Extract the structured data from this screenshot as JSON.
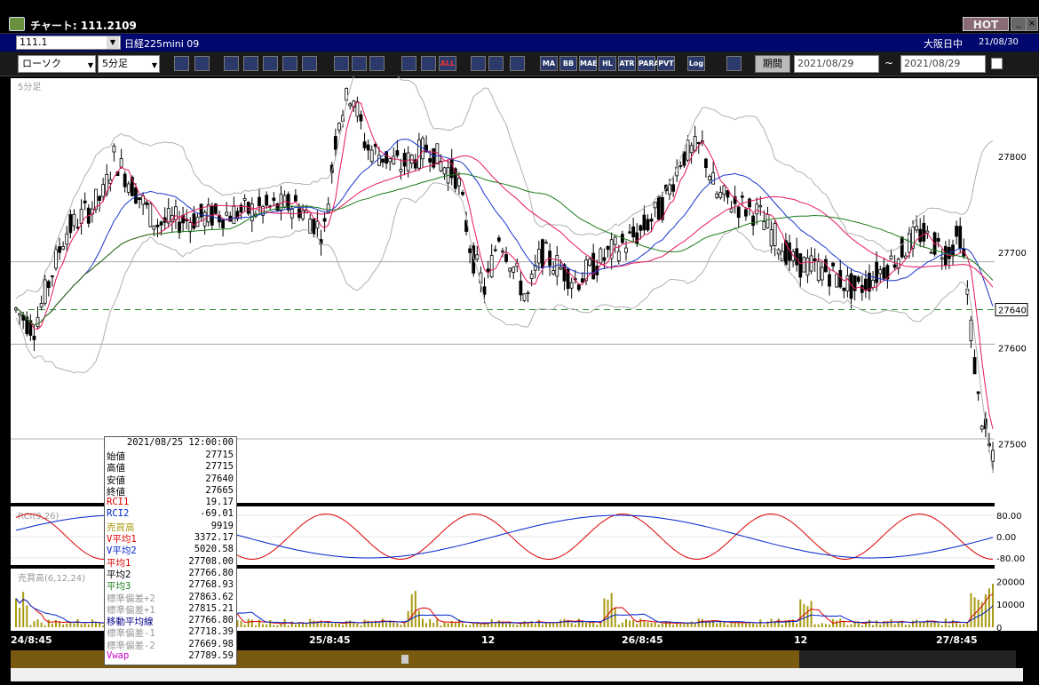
{
  "window": {
    "title": "チャート: 111.2109",
    "hot_label": "HOT",
    "min_icon": "minimize-icon",
    "close_icon": "close-icon"
  },
  "symbol_bar": {
    "symbol": "111.1",
    "name": "日経225mini 09",
    "session": "大阪日中",
    "date": "21/08/30"
  },
  "toolbar": {
    "chart_type": "ローソク",
    "interval": "5分足",
    "tool_icons": [
      "zoom-icon",
      "crosshair-icon",
      "tool-icon-3",
      "tool-icon-4",
      "tool-icon-5",
      "tool-icon-6",
      "tool-icon-7",
      "line-draw-icon",
      "cursor-icon",
      "arrow-icon",
      "candle-icon-1",
      "candle-icon-2"
    ],
    "all_label": "ALL",
    "indicator_buttons": [
      "MA",
      "BB",
      "MAE",
      "HL",
      "ATR",
      "PARA",
      "PVT",
      "Log"
    ],
    "period_label": "期間",
    "from_date": "2021/08/29",
    "to_date": "2021/08/29",
    "tilde": "~"
  },
  "main_panel": {
    "label": "5分足",
    "y_ticks": [
      "27800",
      "27700",
      "27600",
      "27500"
    ],
    "current_price": "27640",
    "colors": {
      "bull": "#ffffff",
      "bear": "#000000",
      "ma_red": "#e8175d",
      "ma_blue": "#1a35cc",
      "ma_green": "#1a7a1a",
      "band": "#b0b0b0",
      "ref_line": "#2a8a2a"
    }
  },
  "rci_panel": {
    "label": "RCI(9,26)",
    "ticks": [
      "80.00",
      "0.00",
      "-80.00"
    ],
    "colors": {
      "rci1": "#dd0000",
      "rci2": "#0022cc"
    }
  },
  "volume_panel": {
    "label": "売買高(6,12,24)",
    "ticks": [
      "20000",
      "10000",
      "0"
    ],
    "colors": {
      "bar": "#a89a10"
    }
  },
  "x_axis": {
    "labels": [
      "24/8:45",
      "25/8:45",
      "12",
      "26/8:45",
      "12",
      "27/8:45"
    ]
  },
  "tooltip": {
    "datetime": "2021/08/25 12:00:00",
    "rows": [
      {
        "label": "始値",
        "value": "27715",
        "color": "#000000"
      },
      {
        "label": "高値",
        "value": "27715",
        "color": "#000000"
      },
      {
        "label": "安値",
        "value": "27640",
        "color": "#000000"
      },
      {
        "label": "終値",
        "value": "27665",
        "color": "#000000"
      },
      {
        "label": "RCI1",
        "value": "19.17",
        "color": "#dd0000"
      },
      {
        "label": "RCI2",
        "value": "-69.01",
        "color": "#0022cc"
      },
      {
        "label": "売買高",
        "value": "9919",
        "color": "#a89a10"
      },
      {
        "label": "V平均1",
        "value": "3372.17",
        "color": "#dd0000"
      },
      {
        "label": "V平均2",
        "value": "5020.58",
        "color": "#0022cc"
      },
      {
        "label": "平均1",
        "value": "27708.00",
        "color": "#dd0000"
      },
      {
        "label": "平均2",
        "value": "27766.80",
        "color": "#000000"
      },
      {
        "label": "平均3",
        "value": "27768.93",
        "color": "#1a7a1a"
      },
      {
        "label": "標準偏差+2",
        "value": "27863.62",
        "color": "#999999"
      },
      {
        "label": "標準偏差+1",
        "value": "27815.21",
        "color": "#999999"
      },
      {
        "label": "移動平均線",
        "value": "27766.80",
        "color": "#000088"
      },
      {
        "label": "標準偏差-1",
        "value": "27718.39",
        "color": "#999999"
      },
      {
        "label": "標準偏差-2",
        "value": "27669.98",
        "color": "#999999"
      },
      {
        "label": "Vwap",
        "value": "27789.59",
        "color": "#cc00cc"
      }
    ]
  }
}
